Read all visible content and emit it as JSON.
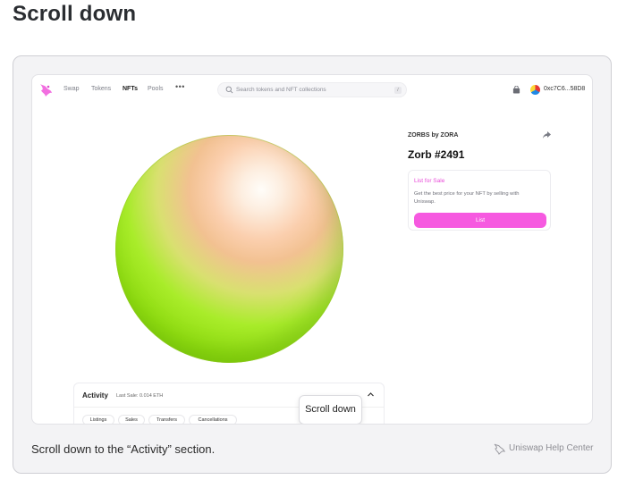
{
  "page": {
    "heading": "Scroll down",
    "caption": "Scroll down to the “Activity” section.",
    "help_center": "Uniswap Help Center"
  },
  "nav": {
    "items": [
      {
        "label": "Swap",
        "active": false
      },
      {
        "label": "Tokens",
        "active": false
      },
      {
        "label": "NFTs",
        "active": true
      },
      {
        "label": "Pools",
        "active": false
      }
    ],
    "more": "•••",
    "search_placeholder": "Search tokens and NFT collections",
    "search_shortcut": "/",
    "wallet_address": "0xc7C6...58D8"
  },
  "nft": {
    "collection": "ZORBS by ZORA",
    "title": "Zorb #2491",
    "sale_heading": "List for Sale",
    "sale_description": "Get the best price for your NFT by selling with Uniswap.",
    "list_button": "List"
  },
  "activity": {
    "title": "Activity",
    "last_sale": "Last Sale: 0.014 ETH",
    "filters": [
      "Listings",
      "Sales",
      "Transfers",
      "Cancellations"
    ]
  },
  "tooltip": "Scroll down",
  "colors": {
    "accent_pink": "#f659e0",
    "orb_green": "#a9ec2a",
    "orb_peach": "#fbcfae"
  }
}
